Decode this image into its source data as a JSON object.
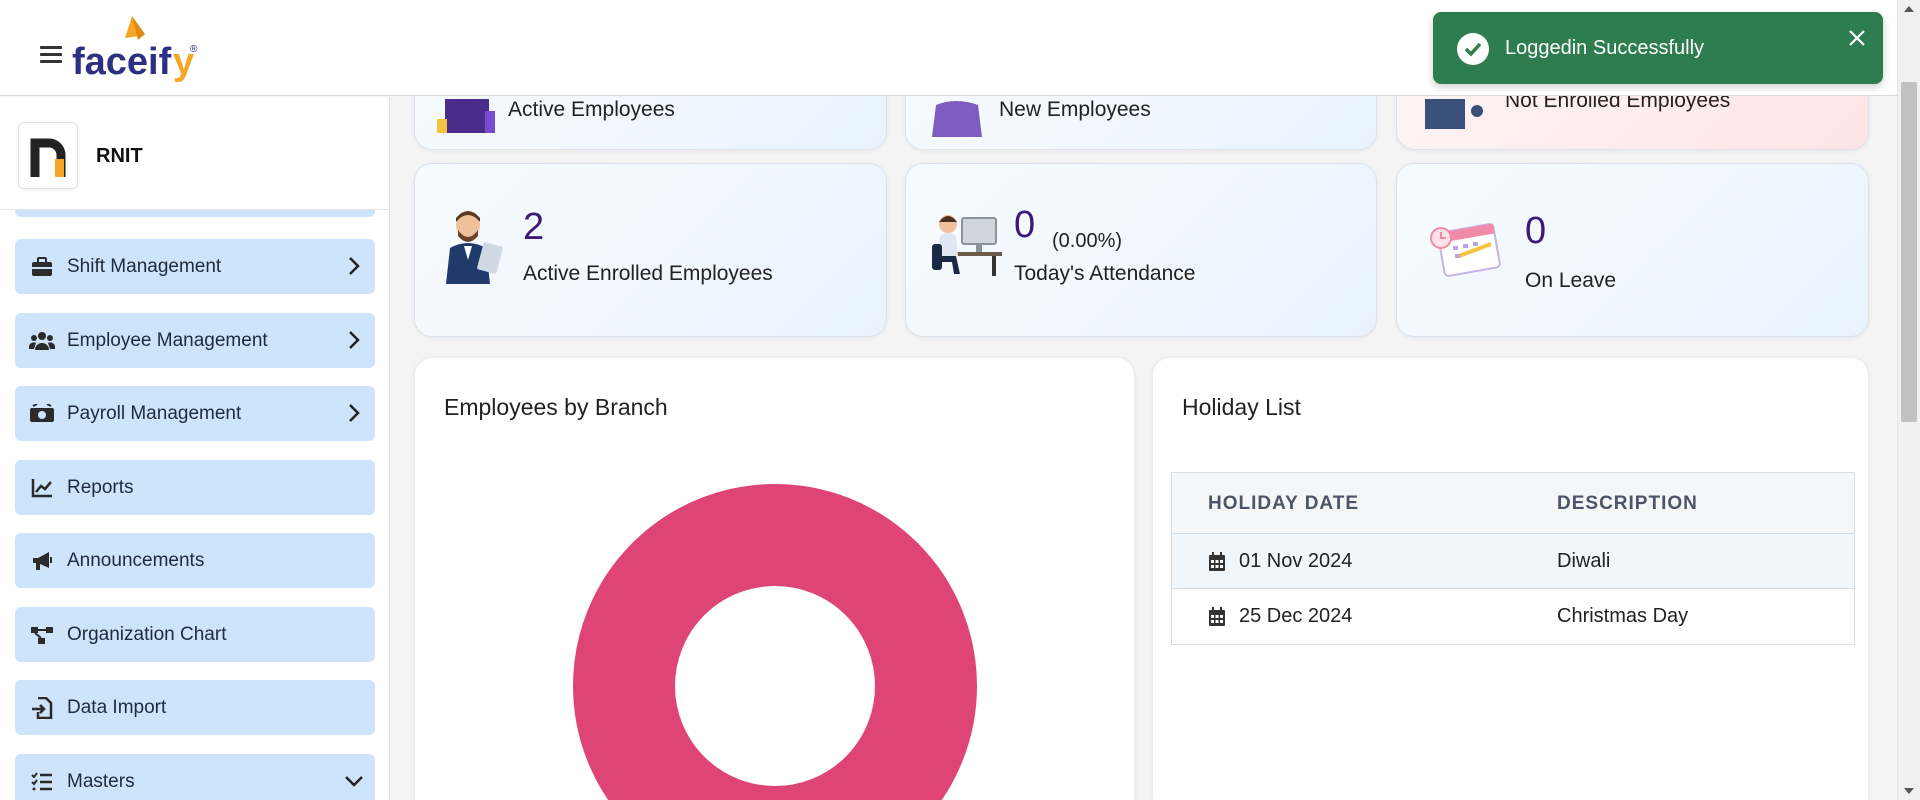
{
  "header": {
    "brand": "faceify",
    "brand_mark": "®"
  },
  "toast": {
    "message": "Loggedin Successfully",
    "color": "#2e7d4f"
  },
  "sidebar": {
    "org_name": "RNIT",
    "org_logo_letter": "n",
    "items": [
      {
        "label": "Shift Management",
        "icon": "briefcase-icon",
        "expand": "chevron-right"
      },
      {
        "label": "Employee Management",
        "icon": "users-icon",
        "expand": "chevron-right"
      },
      {
        "label": "Payroll Management",
        "icon": "money-icon",
        "expand": "chevron-right"
      },
      {
        "label": "Reports",
        "icon": "line-chart-icon"
      },
      {
        "label": "Announcements",
        "icon": "megaphone-icon"
      },
      {
        "label": "Organization Chart",
        "icon": "org-chart-icon"
      },
      {
        "label": "Data Import",
        "icon": "file-import-icon"
      },
      {
        "label": "Masters",
        "icon": "list-check-icon",
        "expand": "chevron-down"
      }
    ],
    "item_color": "#cde4fb"
  },
  "stats_top": [
    {
      "label": "Active Employees"
    },
    {
      "label": "New Employees"
    },
    {
      "label": "Not Enrolled Employees"
    }
  ],
  "stats": [
    {
      "value": "2",
      "label": "Active Enrolled Employees"
    },
    {
      "value": "0",
      "percent": "(0.00%)",
      "label": "Today's Attendance"
    },
    {
      "value": "0",
      "label": "On Leave"
    }
  ],
  "branch_panel": {
    "title": "Employees by Branch"
  },
  "chart_data": {
    "type": "pie",
    "donut": true,
    "categories": [
      ""
    ],
    "values": [
      1
    ],
    "colors": [
      "#de4576"
    ]
  },
  "holiday_panel": {
    "title": "Holiday List",
    "columns": [
      "HOLIDAY DATE",
      "DESCRIPTION"
    ],
    "rows": [
      {
        "date": "01 Nov 2024",
        "description": "Diwali"
      },
      {
        "date": "25 Dec 2024",
        "description": "Christmas Day"
      }
    ]
  },
  "colors": {
    "stat_number": "#3c1a78",
    "donut": "#de4576"
  }
}
